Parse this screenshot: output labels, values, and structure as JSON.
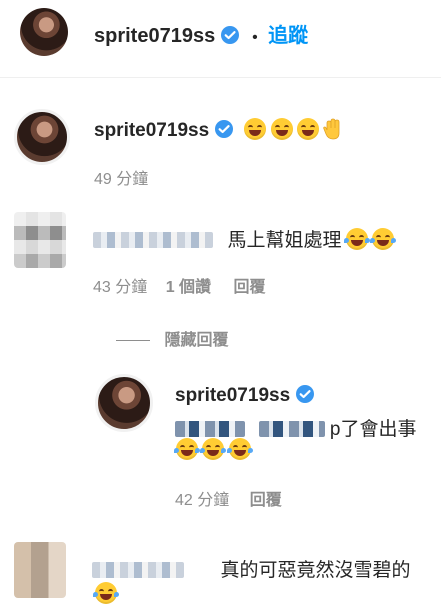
{
  "header": {
    "username": "sprite0719ss",
    "separator": "•",
    "follow_label": "追蹤"
  },
  "comments": [
    {
      "username": "sprite0719ss",
      "time": "49 分鐘"
    },
    {
      "text": "馬上幫姐處理",
      "time": "43 分鐘",
      "likes": "1 個讚",
      "reply_label": "回覆"
    }
  ],
  "hide_replies_label": "隱藏回覆",
  "reply": {
    "username": "sprite0719ss",
    "text_suffix": "p了會出事",
    "time": "42 分鐘",
    "reply_label": "回覆"
  },
  "last_comment": {
    "text": "真的可惡竟然沒雪碧的"
  },
  "colors": {
    "follow": "#0095f6",
    "verified": "#3897f0",
    "secondary_text": "#8e8e8e"
  }
}
